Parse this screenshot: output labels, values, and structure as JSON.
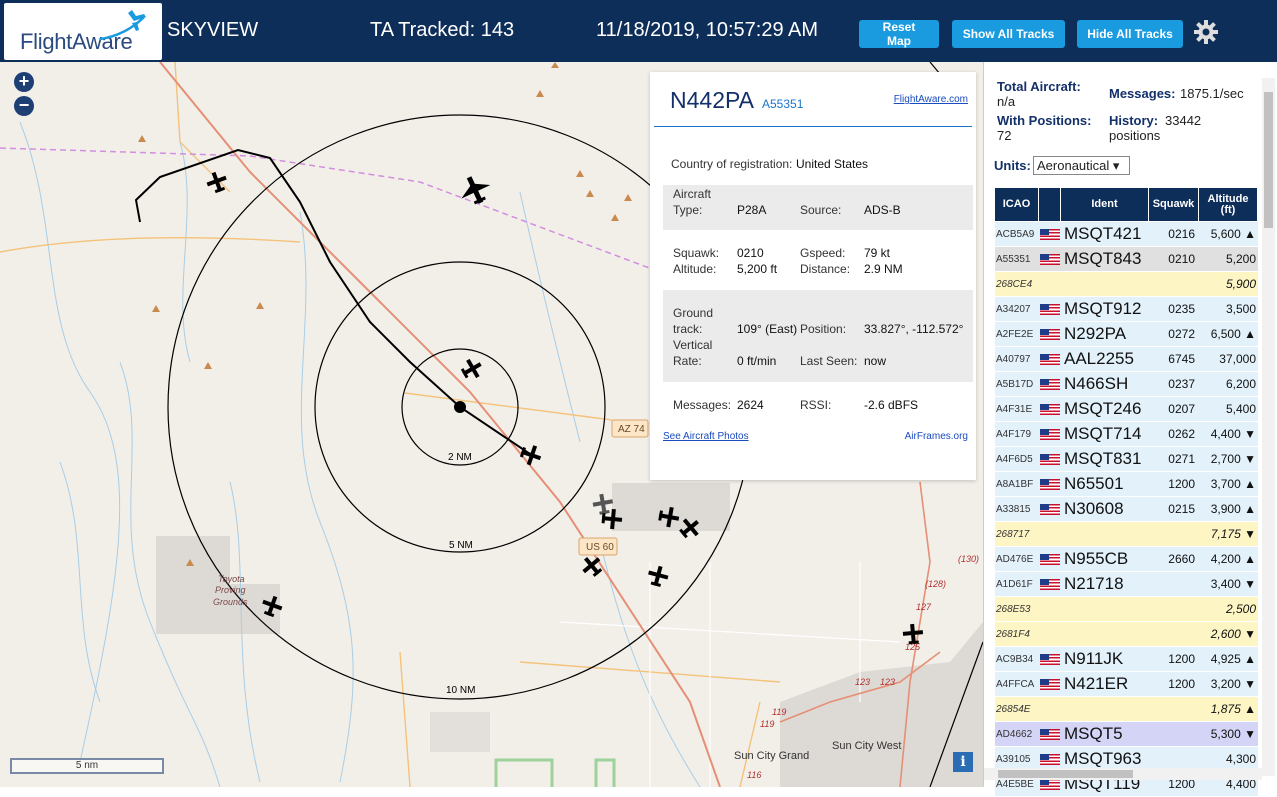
{
  "header": {
    "logo": "FlightAware",
    "site": "SKYVIEW",
    "tracked": "TA Tracked: 143",
    "datetime": "11/18/2019, 10:57:29 AM",
    "reset_map": "Reset Map",
    "show_all": "Show All Tracks",
    "hide_all": "Hide All Tracks"
  },
  "map": {
    "zoom_in": "+",
    "zoom_out": "−",
    "range_rings": [
      "2 NM",
      "5 NM",
      "10 NM"
    ],
    "road_labels": [
      "AZ 74",
      "US 60"
    ],
    "place_labels": [
      "Toyota",
      "Proving",
      "Grounds",
      "Sun City Grand",
      "Sun City West"
    ],
    "road_numbers": [
      "(130)",
      "(128)",
      "127",
      "125",
      "123",
      "123",
      "119",
      "119",
      "116"
    ],
    "scale": "5 nm",
    "info": "i",
    "colors": {
      "land": "#f2efe9",
      "road": "#f4c27a",
      "highway": "#e58f77",
      "water": "#a8cde6"
    }
  },
  "popup": {
    "registration": "N442PA",
    "hex": "A55351",
    "fa_link": "FlightAware.com",
    "country_label": "Country of registration:",
    "country": "United States",
    "aircraft_type_label1": "Aircraft",
    "aircraft_type_label2": "Type:",
    "aircraft_type": "P28A",
    "source_label": "Source:",
    "source": "ADS-B",
    "squawk_label": "Squawk:",
    "squawk": "0210",
    "gspeed_label": "Gspeed:",
    "gspeed": "79 kt",
    "altitude_label": "Altitude:",
    "altitude": "5,200 ft",
    "distance_label": "Distance:",
    "distance": "2.9 NM",
    "ground_label1": "Ground",
    "ground_label2": "track:",
    "ground_track": "109° (East)",
    "position_label": "Position:",
    "position": "33.827°, -112.572°",
    "vertical_label1": "Vertical",
    "vertical_label2": "Rate:",
    "vertical_rate": "0 ft/min",
    "last_seen_label": "Last Seen:",
    "last_seen": "now",
    "messages_label": "Messages:",
    "messages": "2624",
    "rssi_label": "RSSI:",
    "rssi": "-2.6 dBFS",
    "photos_link": "See Aircraft Photos",
    "airframes_link": "AirFrames.org"
  },
  "sidebar": {
    "total_label": "Total Aircraft:",
    "total": "n/a",
    "messages_label": "Messages:",
    "messages": "1875.1/sec",
    "positions_label": "With Positions:",
    "positions": "72",
    "history_label": "History:",
    "history1": "33442",
    "history2": "positions",
    "units_label": "Units:",
    "units_value": "Aeronautical ▾",
    "columns": [
      "ICAO",
      "Ident",
      "Squawk",
      "Altitude (ft)"
    ],
    "rows": [
      {
        "icao": "ACB5A9",
        "ident": "MSQT421",
        "squawk": "0216",
        "alt": "5,600 ▲",
        "flag": true,
        "bg": "#e3f1fb"
      },
      {
        "icao": "A55351",
        "ident": "MSQT843",
        "squawk": "0210",
        "alt": "5,200",
        "flag": true,
        "bg": "#e0e0e0"
      },
      {
        "icao": "268CE4",
        "ident": "",
        "squawk": "",
        "alt": "5,900",
        "flag": false,
        "bg": "#fdf5c4"
      },
      {
        "icao": "A34207",
        "ident": "MSQT912",
        "squawk": "0235",
        "alt": "3,500",
        "flag": true,
        "bg": "#e3f1fb"
      },
      {
        "icao": "A2FE2E",
        "ident": "N292PA",
        "squawk": "0272",
        "alt": "6,500 ▲",
        "flag": true,
        "bg": "#e3f1fb"
      },
      {
        "icao": "A40797",
        "ident": "AAL2255",
        "squawk": "6745",
        "alt": "37,000",
        "flag": true,
        "bg": "#e3f1fb"
      },
      {
        "icao": "A5B17D",
        "ident": "N466SH",
        "squawk": "0237",
        "alt": "6,200",
        "flag": true,
        "bg": "#e3f1fb"
      },
      {
        "icao": "A4F31E",
        "ident": "MSQT246",
        "squawk": "0207",
        "alt": "5,400",
        "flag": true,
        "bg": "#e3f1fb"
      },
      {
        "icao": "A4F179",
        "ident": "MSQT714",
        "squawk": "0262",
        "alt": "4,400 ▼",
        "flag": true,
        "bg": "#e3f1fb"
      },
      {
        "icao": "A4F6D5",
        "ident": "MSQT831",
        "squawk": "0271",
        "alt": "2,700 ▼",
        "flag": true,
        "bg": "#e3f1fb"
      },
      {
        "icao": "A8A1BF",
        "ident": "N65501",
        "squawk": "1200",
        "alt": "3,700 ▲",
        "flag": true,
        "bg": "#e3f1fb"
      },
      {
        "icao": "A33815",
        "ident": "N30608",
        "squawk": "0215",
        "alt": "3,900 ▲",
        "flag": true,
        "bg": "#e3f1fb"
      },
      {
        "icao": "268717",
        "ident": "",
        "squawk": "",
        "alt": "7,175 ▼",
        "flag": false,
        "bg": "#fdf5c4"
      },
      {
        "icao": "AD476E",
        "ident": "N955CB",
        "squawk": "2660",
        "alt": "4,200 ▲",
        "flag": true,
        "bg": "#e3f1fb"
      },
      {
        "icao": "A1D61F",
        "ident": "N21718",
        "squawk": "",
        "alt": "3,400 ▼",
        "flag": true,
        "bg": "#e3f1fb"
      },
      {
        "icao": "268E53",
        "ident": "",
        "squawk": "",
        "alt": "2,500",
        "flag": false,
        "bg": "#fdf5c4"
      },
      {
        "icao": "2681F4",
        "ident": "",
        "squawk": "",
        "alt": "2,600 ▼",
        "flag": false,
        "bg": "#fdf5c4"
      },
      {
        "icao": "AC9B34",
        "ident": "N911JK",
        "squawk": "1200",
        "alt": "4,925 ▲",
        "flag": true,
        "bg": "#e3f1fb"
      },
      {
        "icao": "A4FFCA",
        "ident": "N421ER",
        "squawk": "1200",
        "alt": "3,200 ▼",
        "flag": true,
        "bg": "#e3f1fb"
      },
      {
        "icao": "26854E",
        "ident": "",
        "squawk": "",
        "alt": "1,875 ▲",
        "flag": false,
        "bg": "#fdf5c4"
      },
      {
        "icao": "AD4662",
        "ident": "MSQT5",
        "squawk": "",
        "alt": "5,300 ▼",
        "flag": true,
        "bg": "#d4d4f6"
      },
      {
        "icao": "A39105",
        "ident": "MSQT963",
        "squawk": "",
        "alt": "4,300",
        "flag": true,
        "bg": "#e3f1fb"
      },
      {
        "icao": "A4E5BE",
        "ident": "MSQT119",
        "squawk": "1200",
        "alt": "4,400",
        "flag": true,
        "bg": "#e3f1fb"
      }
    ]
  }
}
